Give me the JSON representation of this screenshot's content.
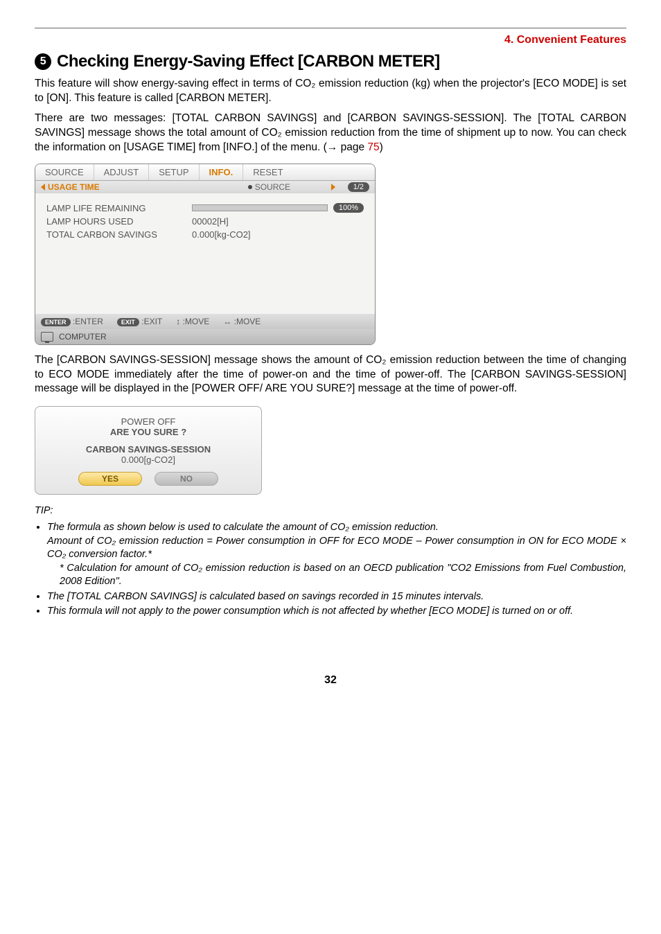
{
  "header": {
    "section": "4. Convenient Features"
  },
  "title": {
    "num": "5",
    "text": "Checking Energy-Saving Effect [CARBON METER]"
  },
  "para1": "This feature will show energy-saving effect in terms of CO₂ emission reduction (kg) when the projector's [ECO MODE] is set to [ON]. This feature is called [CARBON METER].",
  "para2_a": "There are two messages: [TOTAL CARBON SAVINGS] and [CARBON SAVINGS-SESSION]. The [TOTAL CARBON SAVINGS] message shows the total amount of CO₂ emission reduction from the time of shipment up to now. You can check the information on [USAGE TIME] from [INFO.] of the menu. (→ page ",
  "para2_ref": "75",
  "para2_b": ")",
  "menu": {
    "tabs": [
      "SOURCE",
      "ADJUST",
      "SETUP",
      "INFO.",
      "RESET"
    ],
    "active_tab": "INFO.",
    "subtab_active": "USAGE TIME",
    "subtab_next": "SOURCE",
    "page_indicator": "1/2",
    "rows": {
      "r1_label": "LAMP LIFE REMAINING",
      "r1_badge": "100%",
      "r2_label": "LAMP HOURS USED",
      "r2_val": "00002[H]",
      "r3_label": "TOTAL CARBON SAVINGS",
      "r3_val": "0.000[kg-CO2]"
    },
    "footer": {
      "enter_btn": "ENTER",
      "enter_lbl": ":ENTER",
      "exit_btn": "EXIT",
      "exit_lbl": ":EXIT",
      "move1": ":MOVE",
      "move2": ":MOVE",
      "computer": "COMPUTER"
    }
  },
  "para3": "The [CARBON SAVINGS-SESSION] message shows the amount of CO₂ emission reduction between the time of changing to ECO MODE immediately after the time of power-on and the time of power-off. The [CARBON SAVINGS-SESSION] message will be displayed in the [POWER OFF/ ARE YOU SURE?] message at the time of power-off.",
  "dialog": {
    "line1": "POWER OFF",
    "line2": "ARE YOU SURE ?",
    "line3": "CARBON SAVINGS-SESSION",
    "line4": "0.000[g-CO2]",
    "yes": "YES",
    "no": "NO"
  },
  "tip": {
    "heading": "TIP:",
    "b1": "The formula as shown below is used to calculate the amount of CO₂ emission reduction.",
    "b1a": "Amount of CO₂ emission reduction = Power consumption in OFF for ECO MODE – Power consumption in ON for ECO MODE × CO₂ conversion factor.*",
    "b1b": "* Calculation for amount of CO₂ emission reduction is based on an OECD publication \"CO2 Emissions from Fuel Combustion, 2008 Edition\".",
    "b2": "The [TOTAL CARBON SAVINGS] is calculated based on savings recorded in 15 minutes intervals.",
    "b3": "This formula will not apply to the power consumption which is not affected by whether [ECO MODE] is turned on or off."
  },
  "page_number": "32"
}
